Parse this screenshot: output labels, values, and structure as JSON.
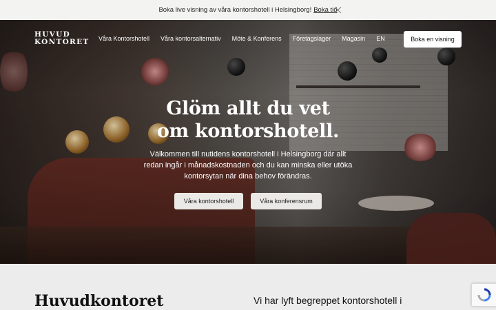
{
  "announcement": {
    "text": "Boka live visning av våra kontorshotell i Helsingborg!",
    "link": "Boka tid"
  },
  "brand": {
    "logo_line1": "HUVUD",
    "logo_line2": "KONTORET"
  },
  "nav": {
    "items": [
      {
        "label": "Våra Kontorshotell"
      },
      {
        "label": "Våra kontorsalternativ"
      },
      {
        "label": "Möte & Konferens"
      },
      {
        "label": "Företagslager"
      },
      {
        "label": "Magasin"
      },
      {
        "label": "EN"
      }
    ],
    "cta": "Boka en visning"
  },
  "hero": {
    "headline_line1": "Glöm allt du vet",
    "headline_line2": "om kontorshotell.",
    "lead": "Välkommen till nutidens kontorshotell i Helsingborg där allt redan ingår i månadskostnaden och du kan minska eller utöka kontorsytan när dina behov förändras.",
    "button1": "Våra kontorshotell",
    "button2": "Våra konferensrum"
  },
  "section": {
    "title": "Huvudkontoret",
    "text": "Vi har lyft begreppet kontorshotell i"
  },
  "icons": {
    "close": "close-icon",
    "recaptcha": "recaptcha-icon"
  }
}
